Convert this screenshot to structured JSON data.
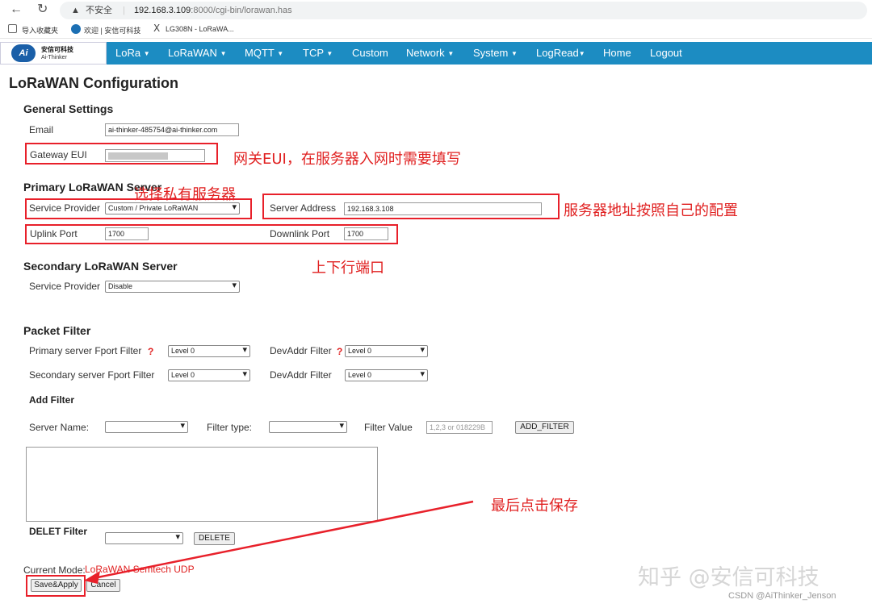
{
  "browser": {
    "nav_back": "←",
    "nav_reload": "↻",
    "security_warning": "▲",
    "security_label": "不安全",
    "url_host": "192.168.3.109",
    "url_rest": ":8000/cgi-bin/lorawan.has",
    "bookmarks": [
      "导入收藏夹",
      "欢迎 | 安信可科技",
      "LG308N - LoRaWA..."
    ]
  },
  "logo": {
    "mark": "Ai",
    "title": "安信可科技",
    "subtitle": "Ai-Thinker"
  },
  "nav": {
    "items": [
      "LoRa",
      "LoRaWAN",
      "MQTT",
      "TCP",
      "Custom",
      "Network",
      "System",
      "LogRead",
      "Home",
      "Logout"
    ]
  },
  "page": {
    "title": "LoRaWAN Configuration"
  },
  "general": {
    "heading": "General Settings",
    "email_label": "Email",
    "email_value": "ai-thinker-485754@ai-thinker.com",
    "gateway_label": "Gateway EUI"
  },
  "primary": {
    "heading": "Primary LoRaWAN Server",
    "provider_label": "Service Provider",
    "provider_value": "Custom / Private LoRaWAN",
    "address_label": "Server Address",
    "address_value": "192.168.3.108",
    "uplink_label": "Uplink Port",
    "uplink_value": "1700",
    "downlink_label": "Downlink Port",
    "downlink_value": "1700"
  },
  "secondary": {
    "heading": "Secondary LoRaWAN Server",
    "provider_label": "Service Provider",
    "provider_value": "Disable"
  },
  "filter": {
    "heading": "Packet Filter",
    "primary_fport_label": "Primary server Fport Filter",
    "primary_fport_value": "Level 0",
    "devaddr_label": "DevAddr Filter",
    "devaddr_value": "Level 0",
    "secondary_fport_label": "Secondary server Fport Filter",
    "secondary_fport_value": "Level 0",
    "devaddr2_label": "DevAddr Filter",
    "devaddr2_value": "Level 0",
    "help": "?",
    "add_heading": "Add Filter",
    "server_name_label": "Server Name:",
    "filter_type_label": "Filter type:",
    "filter_value_label": "Filter Value",
    "filter_value_placeholder": "1,2,3 or 018229B",
    "add_button": "ADD_FILTER",
    "delet_heading": "DELET Filter",
    "delete_button": "DELETE"
  },
  "footer": {
    "mode_label": "Current Mode:",
    "mode_value": "LoRaWAN Semtech UDP",
    "save_button": "Save&Apply",
    "cancel_button": "Cancel"
  },
  "annotations": {
    "gateway": "网关EUI，在服务器入网时需要填写",
    "provider": "选择私有服务器",
    "address": "服务器地址按照自己的配置",
    "ports": "上下行端口",
    "save": "最后点击保存"
  },
  "watermark": {
    "zhihu": "知乎 @安信可科技",
    "csdn": "CSDN @AiThinker_Jenson"
  },
  "colors": {
    "nav": "#1c8cc2",
    "annotation": "#e8202a"
  }
}
